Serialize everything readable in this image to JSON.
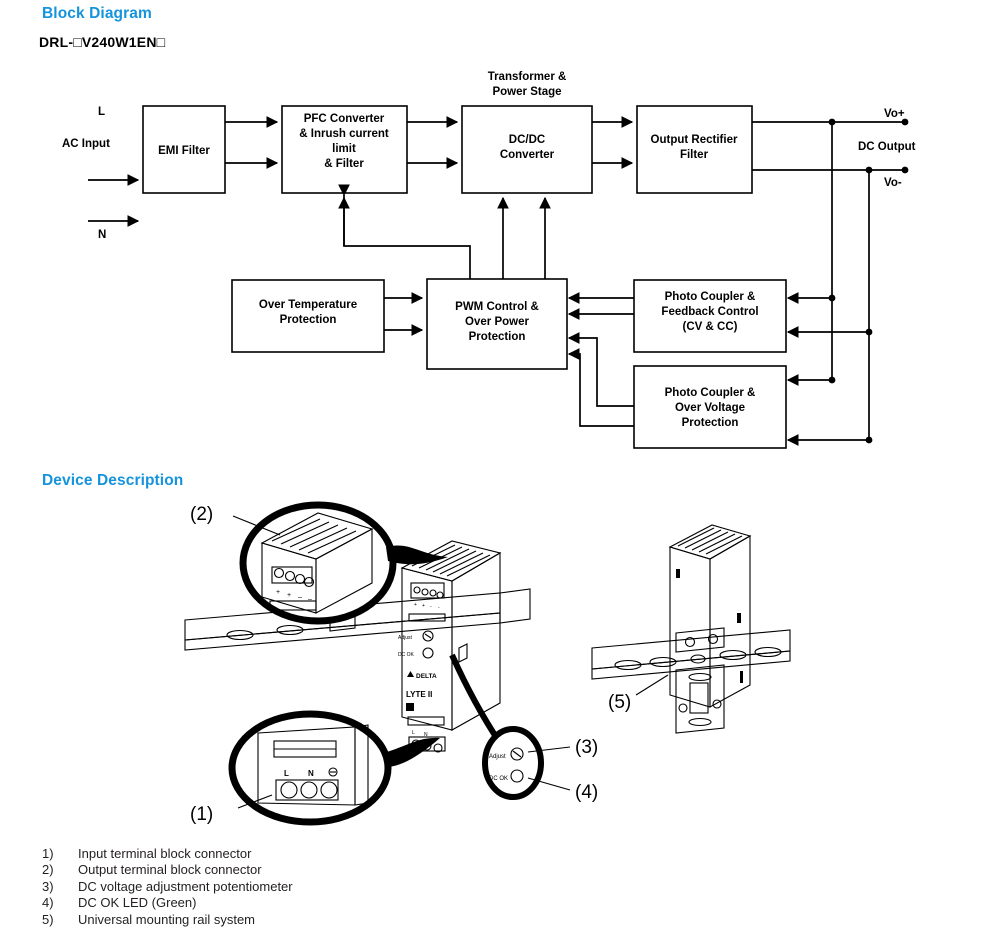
{
  "page": {
    "block_diagram_heading": "Block Diagram",
    "device_description_heading": "Device Description",
    "model_number": "DRL-□V240W1EN□",
    "heading_color": "#1593dc"
  },
  "block_diagram": {
    "blocks": [
      {
        "id": "emi",
        "label": "EMI Filter"
      },
      {
        "id": "pfc",
        "line1": "PFC Converter",
        "line2": "& Inrush current",
        "line3": "limit",
        "line4": "& Filter"
      },
      {
        "id": "dcdc",
        "line1": "DC/DC",
        "line2": "Converter"
      },
      {
        "id": "rect",
        "line1": "Output Rectifier",
        "line2": "Filter"
      },
      {
        "id": "otp",
        "line1": "Over Temperature",
        "line2": "Protection"
      },
      {
        "id": "pwm",
        "line1": "PWM Control &",
        "line2": "Over Power",
        "line3": "Protection"
      },
      {
        "id": "pcfb",
        "line1": "Photo Coupler &",
        "line2": "Feedback Control",
        "line3": "(CV & CC)"
      },
      {
        "id": "pcov",
        "line1": "Photo Coupler &",
        "line2": "Over Voltage",
        "line3": "Protection"
      }
    ],
    "labels": {
      "transformer_1": "Transformer &",
      "transformer_2": "Power Stage",
      "ac_input": "AC Input",
      "line_l": "L",
      "line_n": "N",
      "vo_plus": "Vo+",
      "vo_minus": "Vo-",
      "dc_output": "DC Output"
    }
  },
  "device_description": {
    "callouts": [
      "(1)",
      "(2)",
      "(3)",
      "(4)",
      "(5)"
    ],
    "device_marks": {
      "brand": "DELTA",
      "model": "LYTE II",
      "adjust": "Adjust",
      "dc_ok": "DC OK",
      "terminal_l": "L",
      "terminal_n": "N"
    }
  },
  "legend": {
    "items": [
      {
        "num": "1)",
        "text": "Input terminal block connector"
      },
      {
        "num": "2)",
        "text": "Output terminal block connector"
      },
      {
        "num": "3)",
        "text": "DC voltage adjustment potentiometer"
      },
      {
        "num": "4)",
        "text": "DC OK LED (Green)"
      },
      {
        "num": "5)",
        "text": "Universal mounting rail system"
      }
    ]
  }
}
